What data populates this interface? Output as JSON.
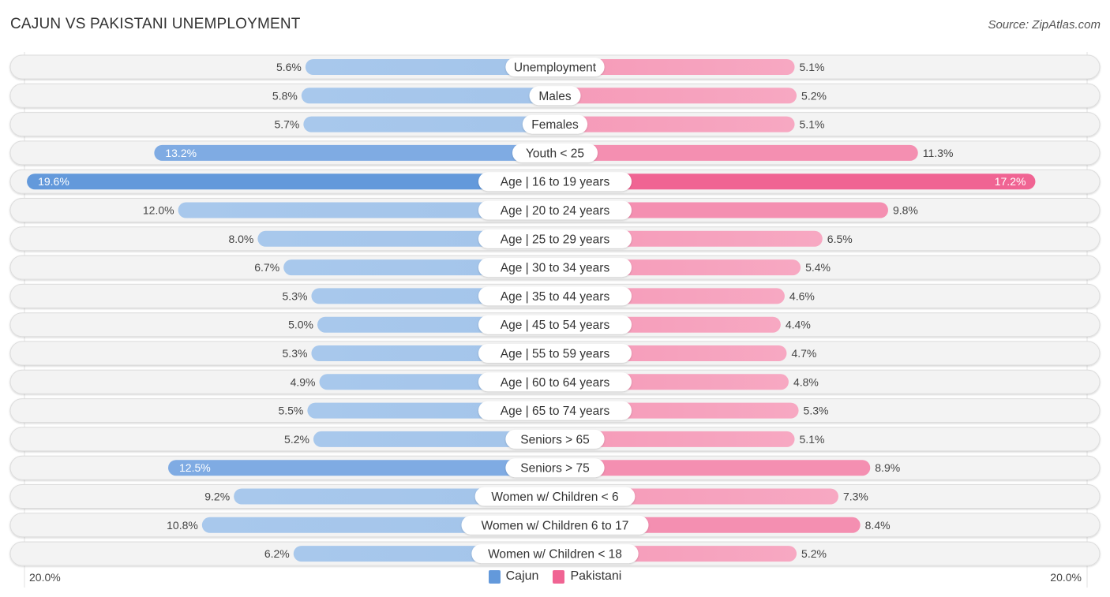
{
  "header": {
    "title": "CAJUN VS PAKISTANI UNEMPLOYMENT",
    "source": "Source: ZipAtlas.com"
  },
  "colors": {
    "cajun_strong": "#6399db",
    "cajun_light": "#a8c8ec",
    "pakistani_strong": "#f06493",
    "pakistani_light": "#f7a8c2",
    "row_bg": "#f3f3f3"
  },
  "chart_data": {
    "type": "bar",
    "orientation": "horizontal-diverging",
    "title": "CAJUN VS PAKISTANI UNEMPLOYMENT",
    "xlabel": "",
    "ylabel": "",
    "axis_min_label": "20.0%",
    "axis_max_label": "20.0%",
    "xlim": [
      0,
      20
    ],
    "legend_position": "bottom-center",
    "categories": [
      "Unemployment",
      "Males",
      "Females",
      "Youth < 25",
      "Age | 16 to 19 years",
      "Age | 20 to 24 years",
      "Age | 25 to 29 years",
      "Age | 30 to 34 years",
      "Age | 35 to 44 years",
      "Age | 45 to 54 years",
      "Age | 55 to 59 years",
      "Age | 60 to 64 years",
      "Age | 65 to 74 years",
      "Seniors > 65",
      "Seniors > 75",
      "Women w/ Children < 6",
      "Women w/ Children 6 to 17",
      "Women w/ Children < 18"
    ],
    "series": [
      {
        "name": "Cajun",
        "side": "left",
        "values": [
          5.6,
          5.8,
          5.7,
          13.2,
          19.6,
          12.0,
          8.0,
          6.7,
          5.3,
          5.0,
          5.3,
          4.9,
          5.5,
          5.2,
          12.5,
          9.2,
          10.8,
          6.2
        ],
        "labels": [
          "5.6%",
          "5.8%",
          "5.7%",
          "13.2%",
          "19.6%",
          "12.0%",
          "8.0%",
          "6.7%",
          "5.3%",
          "5.0%",
          "5.3%",
          "4.9%",
          "5.5%",
          "5.2%",
          "12.5%",
          "9.2%",
          "10.8%",
          "6.2%"
        ]
      },
      {
        "name": "Pakistani",
        "side": "right",
        "values": [
          5.1,
          5.2,
          5.1,
          11.3,
          17.2,
          9.8,
          6.5,
          5.4,
          4.6,
          4.4,
          4.7,
          4.8,
          5.3,
          5.1,
          8.9,
          7.3,
          8.4,
          5.2
        ],
        "labels": [
          "5.1%",
          "5.2%",
          "5.1%",
          "11.3%",
          "17.2%",
          "9.8%",
          "6.5%",
          "5.4%",
          "4.6%",
          "4.4%",
          "4.7%",
          "4.8%",
          "5.3%",
          "5.1%",
          "8.9%",
          "7.3%",
          "8.4%",
          "5.2%"
        ]
      }
    ]
  },
  "legend": {
    "items": [
      {
        "label": "Cajun",
        "color": "#6399db"
      },
      {
        "label": "Pakistani",
        "color": "#f06493"
      }
    ]
  }
}
